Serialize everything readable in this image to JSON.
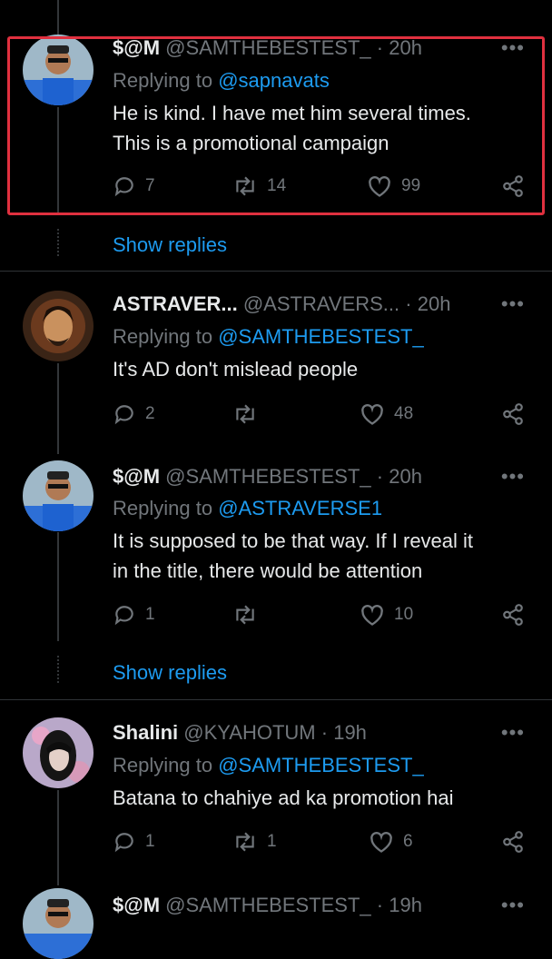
{
  "tweets": [
    {
      "name": "$@M",
      "handle": "@SAMTHEBESTEST_",
      "time": "20h",
      "replying_label": "Replying to",
      "replying_to": "@sapnavats",
      "text_lines": [
        "He is kind. I have met him several times.",
        "This is a promotional campaign"
      ],
      "replies": "7",
      "retweets": "14",
      "likes": "99"
    },
    {
      "name": "ASTRAVER...",
      "handle": "@ASTRAVERS...",
      "time": "20h",
      "replying_label": "Replying to",
      "replying_to": "@SAMTHEBESTEST_",
      "text_lines": [
        "It's AD don't mislead people"
      ],
      "replies": "2",
      "retweets": "",
      "likes": "48"
    },
    {
      "name": "$@M",
      "handle": "@SAMTHEBESTEST_",
      "time": "20h",
      "replying_label": "Replying to",
      "replying_to": "@ASTRAVERSE1",
      "text_lines": [
        "It is supposed to be that way. If I reveal it",
        "in the title, there would be attention"
      ],
      "replies": "1",
      "retweets": "",
      "likes": "10"
    },
    {
      "name": "Shalini",
      "handle": "@KYAHOTUM",
      "time": "19h",
      "replying_label": "Replying to",
      "replying_to": "@SAMTHEBESTEST_",
      "text_lines": [
        "Batana to chahiye ad ka promotion hai"
      ],
      "replies": "1",
      "retweets": "1",
      "likes": "6"
    },
    {
      "name": "$@M",
      "handle": "@SAMTHEBESTEST_",
      "time": "19h"
    }
  ],
  "show_replies_label": "Show replies",
  "more_label": "•••",
  "dot": "·",
  "colors": {
    "highlight": "#e0303f",
    "link": "#1d9bf0",
    "muted": "#71767b"
  }
}
